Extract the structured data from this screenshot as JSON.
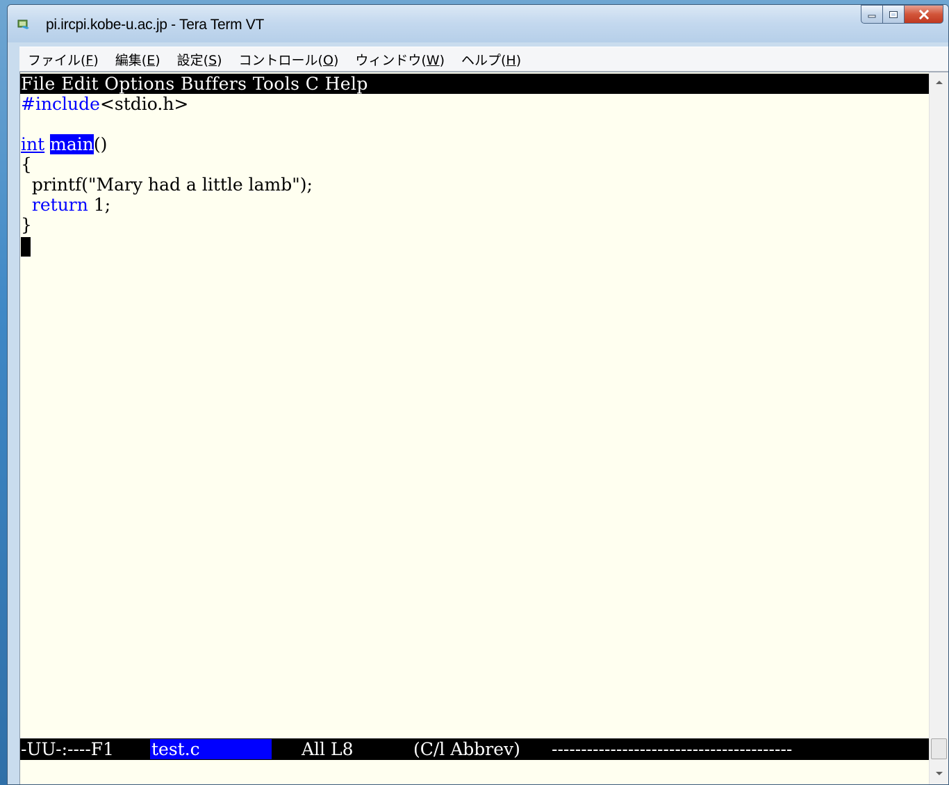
{
  "window": {
    "title": "pi.ircpi.kobe-u.ac.jp - Tera Term VT",
    "icon": "tera-term-app-icon",
    "controls": {
      "minimize_icon": "minimize-icon",
      "maximize_icon": "maximize-icon",
      "close_icon": "close-icon"
    }
  },
  "menubar": {
    "items": [
      {
        "label": "ファイル(",
        "key": "F",
        "suffix": ")"
      },
      {
        "label": "編集(",
        "key": "E",
        "suffix": ")"
      },
      {
        "label": "設定(",
        "key": "S",
        "suffix": ")"
      },
      {
        "label": "コントロール(",
        "key": "O",
        "suffix": ")"
      },
      {
        "label": "ウィンドウ(",
        "key": "W",
        "suffix": ")"
      },
      {
        "label": "ヘルプ(",
        "key": "H",
        "suffix": ")"
      }
    ]
  },
  "emacs": {
    "menu_bar": "File Edit Options Buffers Tools C Help",
    "code": {
      "include_kw": "#include",
      "include_rest": "<stdio.h>",
      "int_kw": "int",
      "main_fn": "main",
      "main_parens": "()",
      "open_brace": "{",
      "printf_line": "  printf(\"Mary had a little lamb\");",
      "return_indent": "  ",
      "return_kw": "return",
      "return_rest": " 1;",
      "close_brace": "}"
    },
    "mode_line": {
      "status": "-UU-:----F1",
      "buffer_name": "test.c",
      "position": "All L8",
      "mode": "(C/l Abbrev)",
      "dashes": "-----------------------------------------"
    }
  },
  "colors": {
    "terminal_bg": "#fffff0",
    "keyword_blue": "#0000ff",
    "highlight_bg": "#0000ff",
    "modeline_bg": "#000000",
    "close_button_red": "#c03820"
  }
}
